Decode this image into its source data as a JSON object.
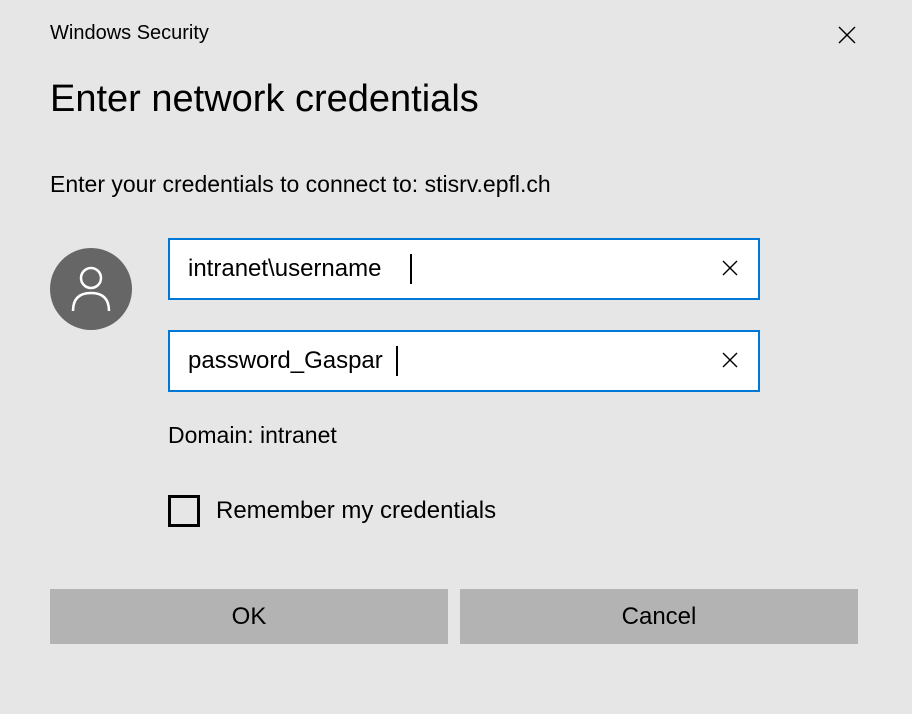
{
  "window_title": "Windows Security",
  "main_title": "Enter network credentials",
  "subtitle": "Enter your credentials to connect to: stisrv.epfl.ch",
  "username_value": "intranet\\username",
  "password_value": "password_Gaspar",
  "domain_label": "Domain: intranet",
  "remember_label": "Remember my credentials",
  "ok_label": "OK",
  "cancel_label": "Cancel"
}
